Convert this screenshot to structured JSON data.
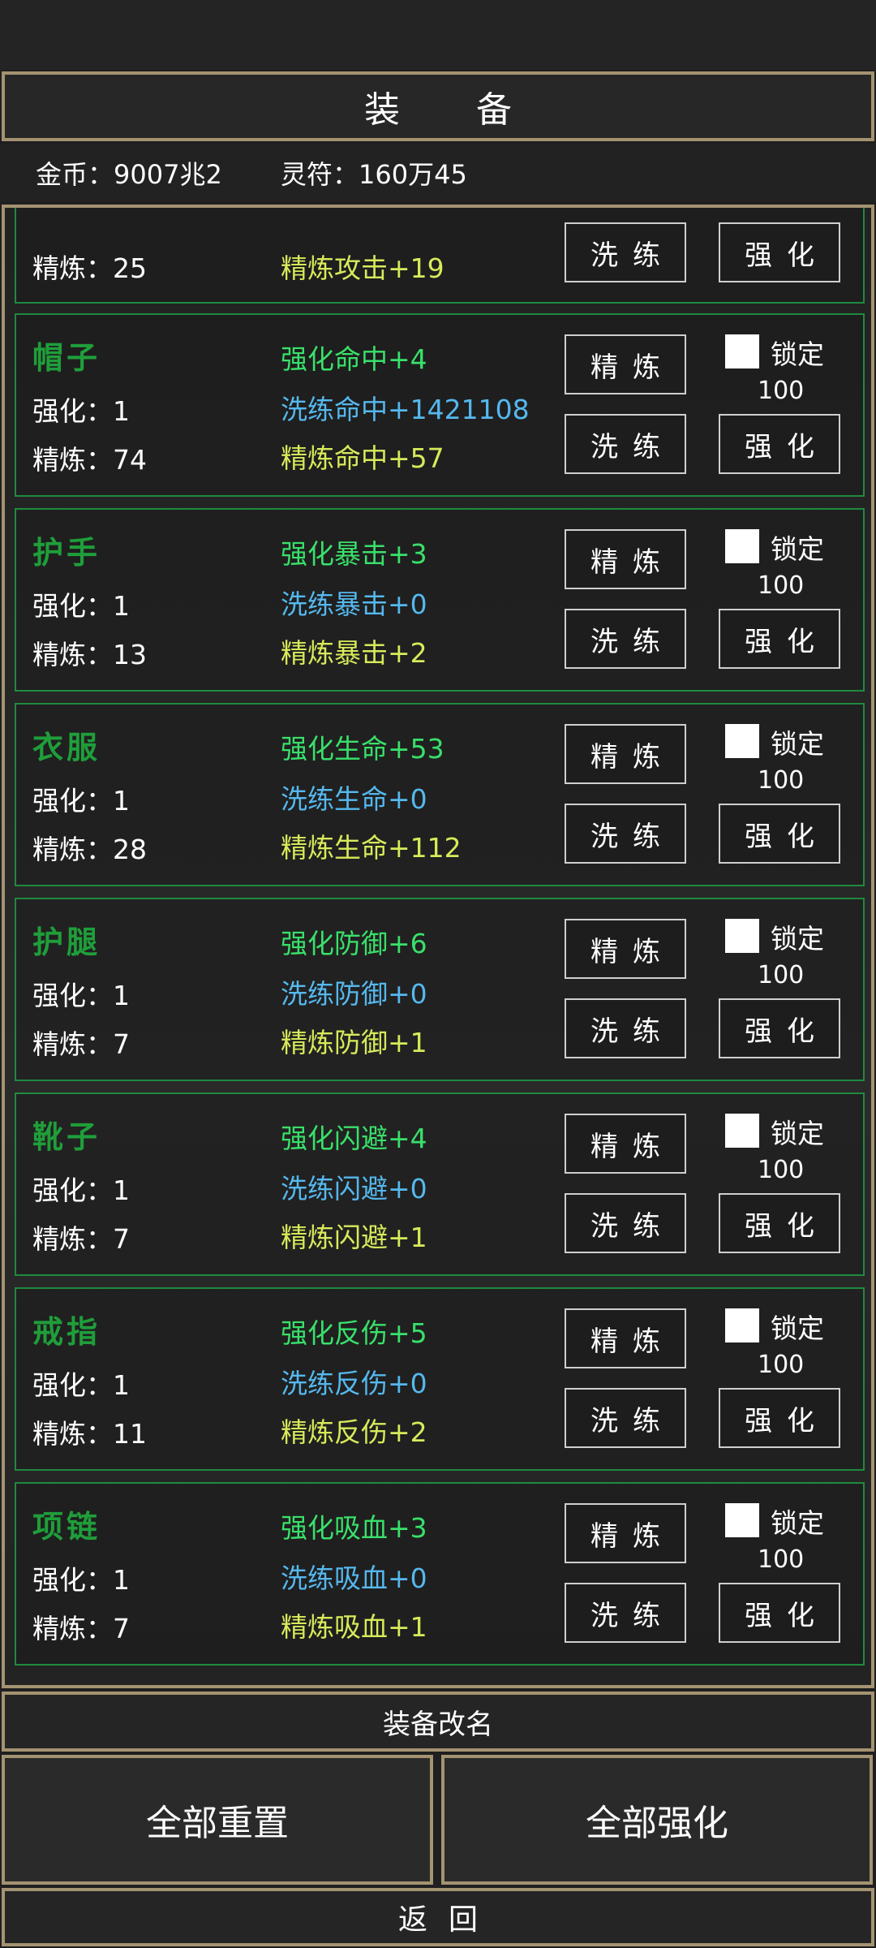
{
  "title": "装 备",
  "currency": {
    "gold": "金币：9007兆2",
    "talisman": "灵符：160万45"
  },
  "partial_item": {
    "level_refine": "精炼：25",
    "stat_refine": "精炼攻击+19",
    "btn_wash": "洗练",
    "btn_strengthen": "强化"
  },
  "items": [
    {
      "name": "帽子",
      "level_strengthen": "强化：1",
      "level_refine": "精炼：74",
      "stat_strengthen": "强化命中+4",
      "stat_wash": "洗练命中+1421108",
      "stat_refine": "精炼命中+57",
      "btn_refine": "精炼",
      "btn_wash": "洗练",
      "btn_strengthen": "强化",
      "lock_label": "锁定",
      "lock_cost": "100"
    },
    {
      "name": "护手",
      "level_strengthen": "强化：1",
      "level_refine": "精炼：13",
      "stat_strengthen": "强化暴击+3",
      "stat_wash": "洗练暴击+0",
      "stat_refine": "精炼暴击+2",
      "btn_refine": "精炼",
      "btn_wash": "洗练",
      "btn_strengthen": "强化",
      "lock_label": "锁定",
      "lock_cost": "100"
    },
    {
      "name": "衣服",
      "level_strengthen": "强化：1",
      "level_refine": "精炼：28",
      "stat_strengthen": "强化生命+53",
      "stat_wash": "洗练生命+0",
      "stat_refine": "精炼生命+112",
      "btn_refine": "精炼",
      "btn_wash": "洗练",
      "btn_strengthen": "强化",
      "lock_label": "锁定",
      "lock_cost": "100"
    },
    {
      "name": "护腿",
      "level_strengthen": "强化：1",
      "level_refine": "精炼：7",
      "stat_strengthen": "强化防御+6",
      "stat_wash": "洗练防御+0",
      "stat_refine": "精炼防御+1",
      "btn_refine": "精炼",
      "btn_wash": "洗练",
      "btn_strengthen": "强化",
      "lock_label": "锁定",
      "lock_cost": "100"
    },
    {
      "name": "靴子",
      "level_strengthen": "强化：1",
      "level_refine": "精炼：7",
      "stat_strengthen": "强化闪避+4",
      "stat_wash": "洗练闪避+0",
      "stat_refine": "精炼闪避+1",
      "btn_refine": "精炼",
      "btn_wash": "洗练",
      "btn_strengthen": "强化",
      "lock_label": "锁定",
      "lock_cost": "100"
    },
    {
      "name": "戒指",
      "level_strengthen": "强化：1",
      "level_refine": "精炼：11",
      "stat_strengthen": "强化反伤+5",
      "stat_wash": "洗练反伤+0",
      "stat_refine": "精炼反伤+2",
      "btn_refine": "精炼",
      "btn_wash": "洗练",
      "btn_strengthen": "强化",
      "lock_label": "锁定",
      "lock_cost": "100"
    },
    {
      "name": "项链",
      "level_strengthen": "强化：1",
      "level_refine": "精炼：7",
      "stat_strengthen": "强化吸血+3",
      "stat_wash": "洗练吸血+0",
      "stat_refine": "精炼吸血+1",
      "btn_refine": "精炼",
      "btn_wash": "洗练",
      "btn_strengthen": "强化",
      "lock_label": "锁定",
      "lock_cost": "100"
    }
  ],
  "footer": {
    "rename": "装备改名",
    "reset_all": "全部重置",
    "strengthen_all": "全部强化",
    "back": "返回"
  }
}
